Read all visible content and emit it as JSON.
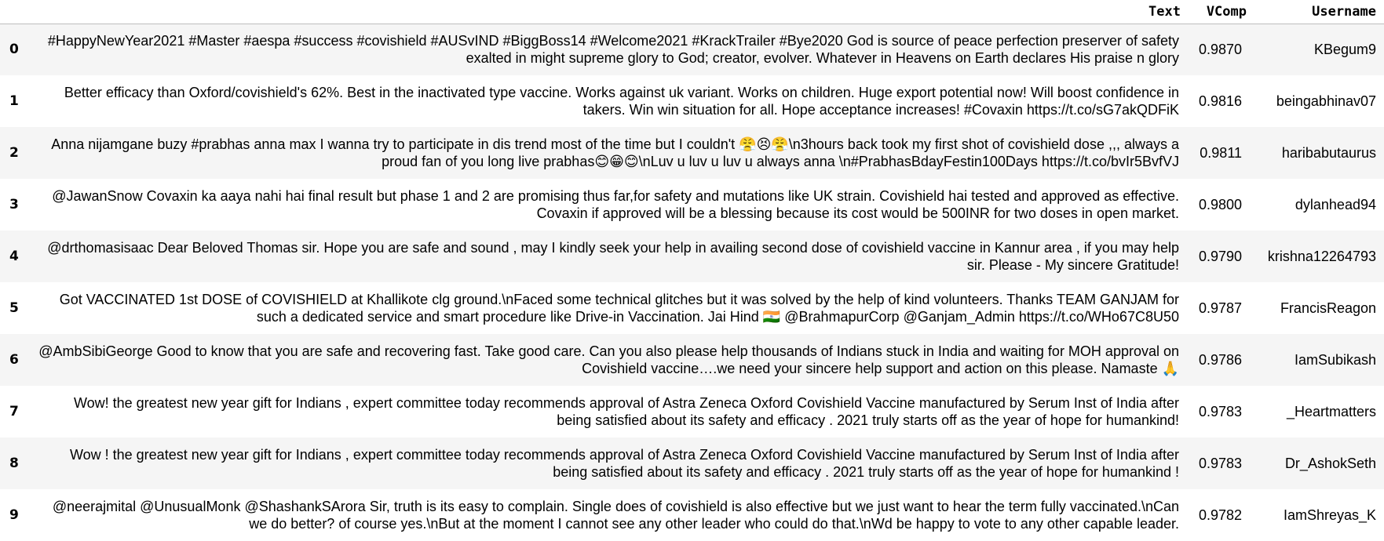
{
  "table": {
    "columns": {
      "index": "",
      "text": "Text",
      "vcomp": "VComp",
      "username": "Username"
    },
    "rows": [
      {
        "index": "0",
        "text": "#HappyNewYear2021 #Master #aespa #success #covishield #AUSvIND #BiggBoss14 #Welcome2021 #KrackTrailer #Bye2020 God is source of peace perfection preserver of safety exalted in might supreme glory to God; creator, evolver. Whatever in Heavens on Earth declares His praise n glory",
        "vcomp": "0.9870",
        "username": "KBegum9"
      },
      {
        "index": "1",
        "text": "Better efficacy than Oxford/covishield's 62%. Best in the inactivated type vaccine. Works against uk variant. Works on children. Huge export potential now! Will boost confidence in takers. Win win situation for all. Hope acceptance increases! #Covaxin https://t.co/sG7akQDFiK",
        "vcomp": "0.9816",
        "username": "beingabhinav07"
      },
      {
        "index": "2",
        "text": "Anna nijamgane buzy #prabhas anna max I wanna try to participate in dis trend most of the time but I couldn't 😤😣😤\\n3hours back took my first shot of covishield dose ,,, always a proud fan of you long live prabhas😊😁😊\\nLuv u luv u luv u always anna \\n#PrabhasBdayFestin100Days https://t.co/bvIr5BvfVJ",
        "vcomp": "0.9811",
        "username": "haribabutaurus"
      },
      {
        "index": "3",
        "text": "@JawanSnow Covaxin ka aaya nahi hai final result but phase 1 and 2 are promising thus far,for safety and mutations like UK strain. Covishield hai tested and approved as effective. Covaxin if approved will be a blessing because its cost would be 500INR for two doses in open market.",
        "vcomp": "0.9800",
        "username": "dylanhead94"
      },
      {
        "index": "4",
        "text": "@drthomasisaac Dear Beloved Thomas sir. Hope you are safe and sound , may I kindly seek your help in availing second dose of covishield vaccine in Kannur area , if you may help sir. Please - My sincere Gratitude!",
        "vcomp": "0.9790",
        "username": "krishna12264793"
      },
      {
        "index": "5",
        "text": "Got VACCINATED 1st DOSE of COVISHIELD at Khallikote clg ground.\\nFaced some technical glitches but it was solved by the help of kind volunteers. Thanks TEAM GANJAM for such a dedicated service and smart procedure like Drive-in Vaccination. Jai Hind 🇮🇳 @BrahmapurCorp @Ganjam_Admin https://t.co/WHo67C8U50",
        "vcomp": "0.9787",
        "username": "FrancisReagon"
      },
      {
        "index": "6",
        "text": "@AmbSibiGeorge Good to know that you are safe and recovering fast. Take good care. Can you also please help thousands of Indians stuck in India and waiting for MOH approval on Covishield vaccine….we need your sincere help support and action on this please. Namaste 🙏",
        "vcomp": "0.9786",
        "username": "IamSubikash"
      },
      {
        "index": "7",
        "text": "Wow! the greatest new year gift for Indians , expert committee today recommends approval of Astra Zeneca Oxford Covishield Vaccine manufactured by Serum Inst of India after being satisfied about its safety and efficacy . 2021 truly starts off as the year of hope for humankind!",
        "vcomp": "0.9783",
        "username": "_Heartmatters"
      },
      {
        "index": "8",
        "text": "Wow ! the greatest new year gift for Indians , expert committee today recommends approval of Astra Zeneca Oxford Covishield Vaccine manufactured by Serum Inst of India after being satisfied about its safety and efficacy . 2021 truly starts off as the year of hope for humankind !",
        "vcomp": "0.9783",
        "username": "Dr_AshokSeth"
      },
      {
        "index": "9",
        "text": "@neerajmital @UnusualMonk @ShashankSArora Sir, truth is its easy to complain. Single does of covishield is also effective but we just want to hear the term fully vaccinated.\\nCan we do better? of course yes.\\nBut at the moment I cannot see any other leader who could do that.\\nWd be happy to vote to any other capable leader.",
        "vcomp": "0.9782",
        "username": "IamShreyas_K"
      }
    ]
  }
}
